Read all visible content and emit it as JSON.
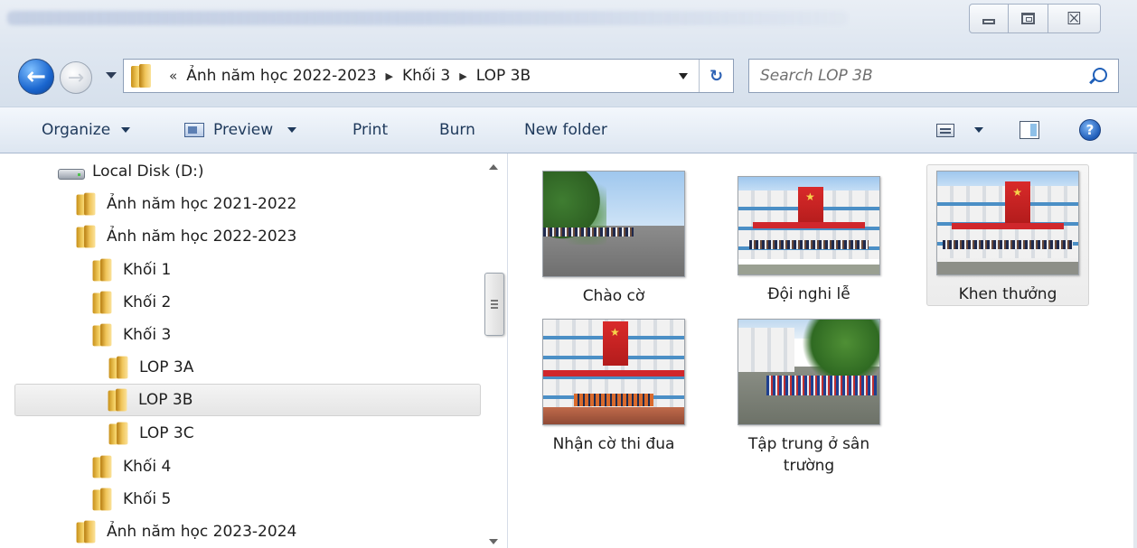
{
  "window": {
    "minimize_label": "",
    "maximize_label": "",
    "close_label": "☒"
  },
  "address": {
    "overflow_glyph": "«",
    "crumbs": [
      "Ảnh năm học 2022-2023",
      "Khối 3",
      "LOP 3B"
    ]
  },
  "search": {
    "placeholder": "Search LOP 3B"
  },
  "toolbar": {
    "organize": "Organize",
    "preview": "Preview",
    "print": "Print",
    "burn": "Burn",
    "new_folder": "New folder"
  },
  "tree": [
    {
      "label": "Local Disk (D:)",
      "icon": "drive-icon",
      "level": 0
    },
    {
      "label": "Ảnh năm học 2021-2022",
      "icon": "folder-icon",
      "level": 1
    },
    {
      "label": "Ảnh năm học 2022-2023",
      "icon": "folder-icon",
      "level": 1
    },
    {
      "label": "Khối 1",
      "icon": "folder-icon",
      "level": 2
    },
    {
      "label": "Khối 2",
      "icon": "folder-icon",
      "level": 2
    },
    {
      "label": "Khối 3",
      "icon": "folder-icon",
      "level": 2
    },
    {
      "label": "LOP 3A",
      "icon": "folder-icon",
      "level": 3
    },
    {
      "label": "LOP 3B",
      "icon": "folder-icon",
      "level": 3,
      "selected": true
    },
    {
      "label": "LOP 3C",
      "icon": "folder-icon",
      "level": 3
    },
    {
      "label": "Khối 4",
      "icon": "folder-icon",
      "level": 2
    },
    {
      "label": "Khối 5",
      "icon": "folder-icon",
      "level": 2
    },
    {
      "label": "Ảnh năm học 2023-2024",
      "icon": "folder-icon",
      "level": 1
    }
  ],
  "files": [
    {
      "label": "Chào cờ",
      "selected": false
    },
    {
      "label": "Đội nghi lễ",
      "selected": false
    },
    {
      "label": "Khen thưởng",
      "selected": true
    },
    {
      "label": "Nhận cờ thi đua",
      "selected": false
    },
    {
      "label": "Tập trung ở sân trường",
      "selected": false
    }
  ]
}
